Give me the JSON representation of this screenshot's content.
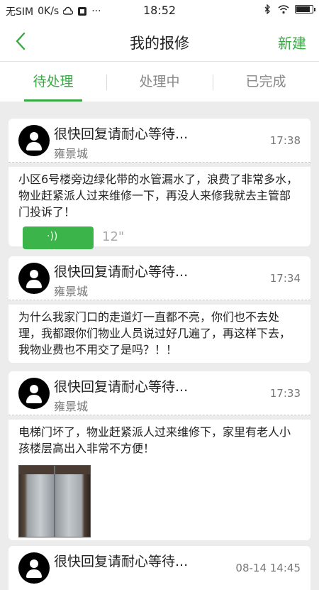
{
  "status_bar": {
    "carrier": "无SIM",
    "speed": "0K/s",
    "more": "···",
    "time": "18:52",
    "battery_level": 0.92
  },
  "nav": {
    "title": "我的报修",
    "right_action": "新建"
  },
  "tabs": [
    {
      "label": "待处理",
      "active": true
    },
    {
      "label": "处理中",
      "active": false
    },
    {
      "label": "已完成",
      "active": false
    }
  ],
  "colors": {
    "accent": "#3aa845",
    "voice": "#3bb54a",
    "background": "#ececec"
  },
  "items": [
    {
      "title": "很快回复请耐心等待...",
      "community": "雍景城",
      "time": "17:38",
      "text": "小区6号楼旁边绿化带的水管漏水了，浪费了非常多水，物业赶紧派人过来维修一下，再没人来修我就去主管部门投诉了！",
      "voice_duration": "12\""
    },
    {
      "title": "很快回复请耐心等待...",
      "community": "雍景城",
      "time": "17:34",
      "text": "为什么我家门口的走道灯一直都不亮，你们也不去处理，我都跟你们物业人员说过好几遍了，再这样下去，我物业费也不用交了是吗？！！"
    },
    {
      "title": "很快回复请耐心等待...",
      "community": "雍景城",
      "time": "17:33",
      "text": "电梯门坏了，物业赶紧派人过来维修下，家里有老人小孩楼层高出入非常不方便！"
    },
    {
      "title": "很快回复请耐心等待...",
      "time": "08-14 14:45"
    }
  ]
}
